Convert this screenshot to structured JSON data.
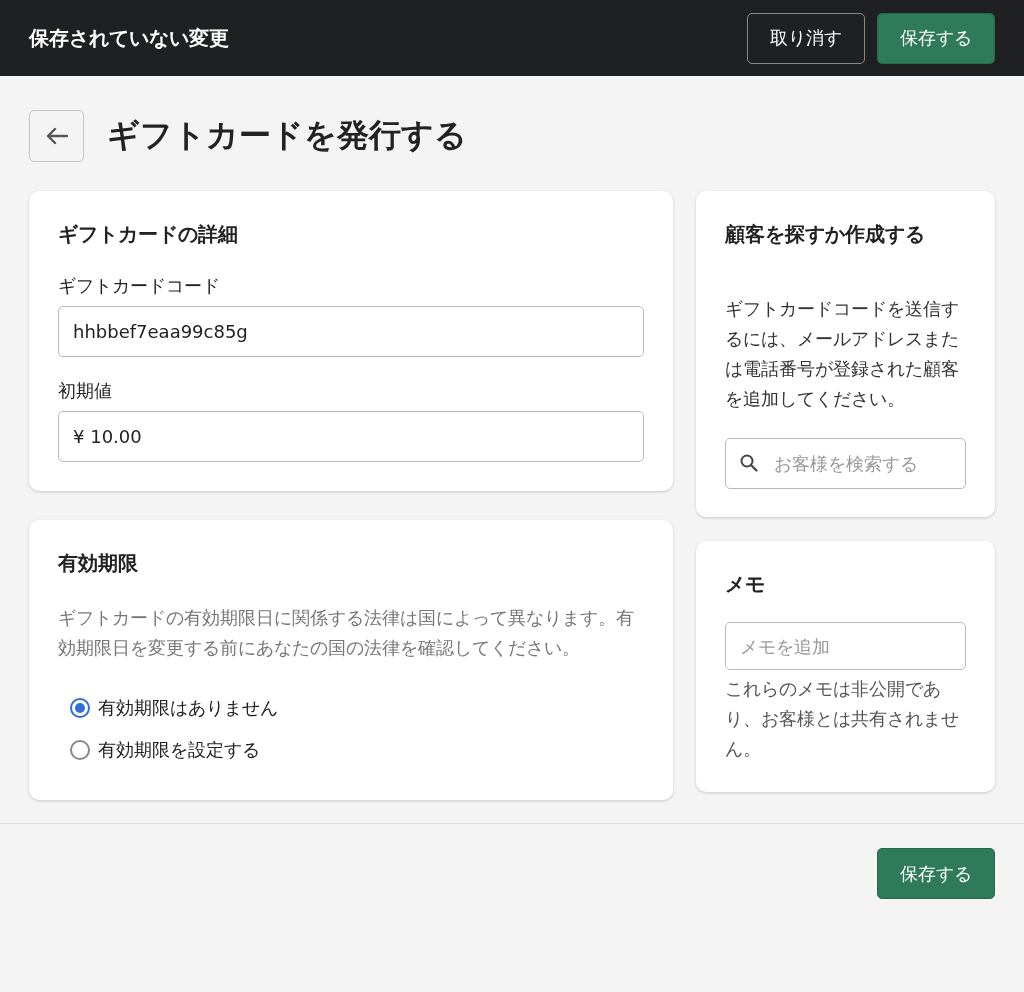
{
  "header": {
    "title": "保存されていない変更",
    "buttons": [
      {
        "label": "取り消す",
        "kind": "secondary"
      },
      {
        "label": "保存する",
        "kind": "primary"
      }
    ]
  },
  "page": {
    "title": "ギフトカードを発行する"
  },
  "details": {
    "title": "ギフトカードの詳細",
    "fields": [
      {
        "label": "ギフトカードコード",
        "value": "hhbbef7eaa99c85g"
      },
      {
        "label": "初期値",
        "value": "¥ 10.00"
      }
    ]
  },
  "expiry": {
    "title": "有効期限",
    "description": "ギフトカードの有効期限日に関係する法律は国によって異なります。有効期限日を変更する前にあなたの国の法律を確認してください。",
    "options": [
      {
        "label": "有効期限はありません",
        "selected": true
      },
      {
        "label": "有効期限を設定する",
        "selected": false
      }
    ]
  },
  "customer": {
    "title": "顧客を探すか作成する",
    "description": "ギフトカードコードを送信するには、メールアドレスまたは電話番号が登録された顧客を追加してください。",
    "search": {
      "placeholder": "お客様を検索する"
    }
  },
  "notes": {
    "title": "メモ",
    "input": {
      "placeholder": "メモを追加"
    },
    "help": "これらのメモは非公開であり、お客様とは共有されません。"
  },
  "footer": {
    "buttons": [
      {
        "label": "保存する",
        "kind": "primary"
      }
    ]
  }
}
